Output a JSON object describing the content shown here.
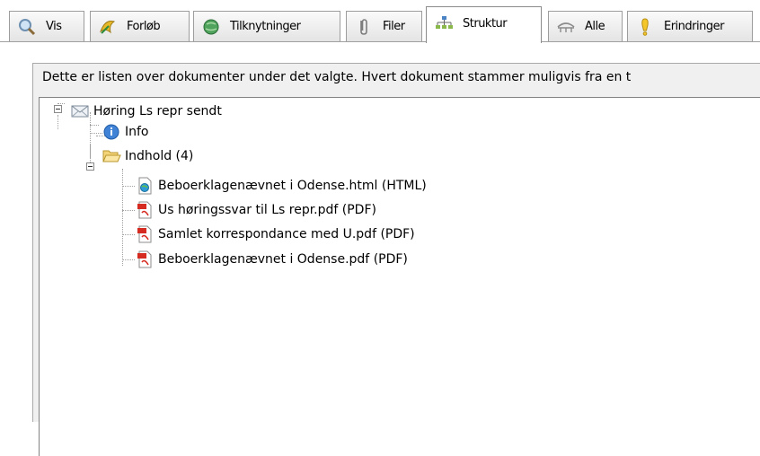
{
  "tabs": [
    {
      "label": "Vis",
      "icon": "magnifier-icon"
    },
    {
      "label": "Forløb",
      "icon": "history-icon"
    },
    {
      "label": "Tilknytninger",
      "icon": "globe-link-icon"
    },
    {
      "label": "Filer",
      "icon": "paperclip-icon"
    },
    {
      "label": "Struktur",
      "icon": "structure-icon",
      "active": true
    },
    {
      "label": "Alle",
      "icon": "bridge-icon"
    },
    {
      "label": "Erindringer",
      "icon": "reminder-icon"
    }
  ],
  "description": "Dette er listen over dokumenter under det valgte. Hvert dokument stammer muligvis fra en t",
  "tree": {
    "root": {
      "label": "Høring Ls repr sendt",
      "icon": "email-icon"
    },
    "info": {
      "label": "Info",
      "icon": "info-icon"
    },
    "folder": {
      "label": "Indhold (4)",
      "icon": "folder-open-icon"
    },
    "files": [
      {
        "label": "Beboerklagenævnet i Odense.html (HTML)",
        "icon": "html-file-icon"
      },
      {
        "label": "Us høringssvar til Ls repr.pdf (PDF)",
        "icon": "pdf-file-icon"
      },
      {
        "label": "Samlet korrespondance med U.pdf (PDF)",
        "icon": "pdf-file-icon"
      },
      {
        "label": "Beboerklagenævnet i Odense.pdf (PDF)",
        "icon": "pdf-file-icon"
      }
    ]
  }
}
